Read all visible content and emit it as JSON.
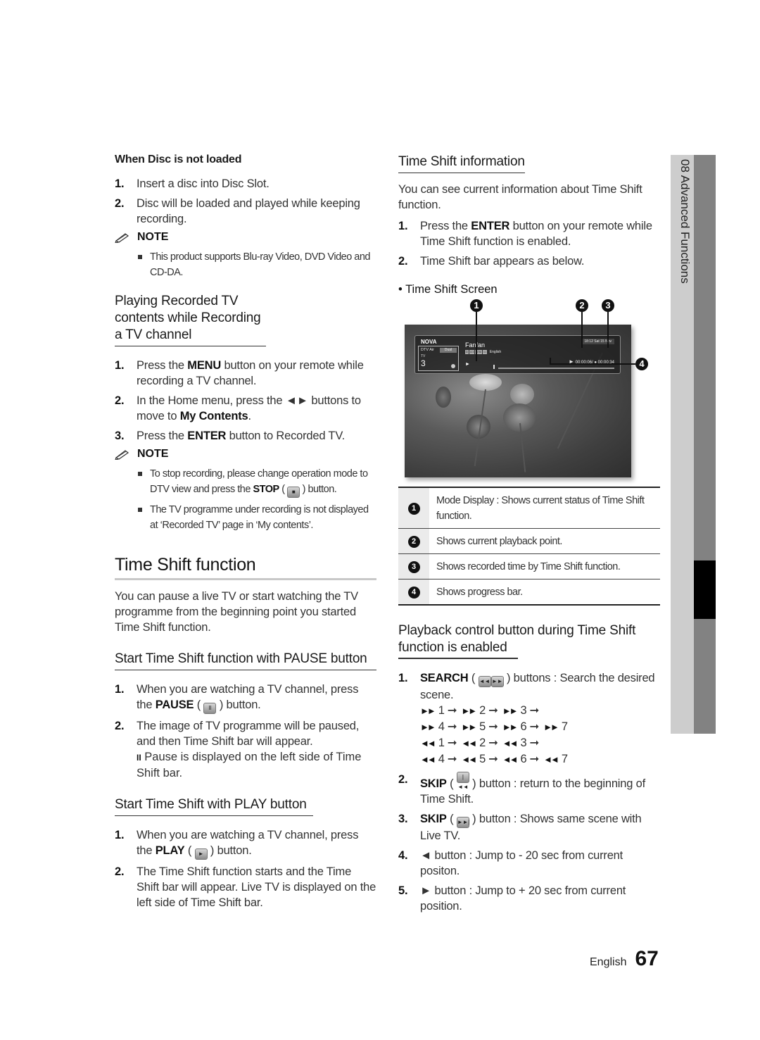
{
  "left": {
    "disc_not_loaded": {
      "title": "When Disc is not loaded",
      "steps": [
        {
          "num": "1.",
          "text": "Insert a disc into Disc Slot."
        },
        {
          "num": "2.",
          "text": "Disc will be loaded and played while keeping recording."
        }
      ],
      "note_label": "NOTE",
      "notes": [
        "This product supports Blu-ray Video, DVD Video and CD-DA."
      ]
    },
    "playing_recorded": {
      "title": "Playing Recorded TV contents while Recording a TV channel",
      "steps": [
        {
          "num": "1.",
          "pre": "Press the ",
          "kw": "MENU",
          "post": " button on your remote while recording a TV channel."
        },
        {
          "num": "2.",
          "pre": "In the Home menu, press the ◄► buttons to move to ",
          "kw": "My Contents",
          "post": "."
        },
        {
          "num": "3.",
          "pre": "Press the ",
          "kw": "ENTER",
          "post": " button to Recorded TV."
        }
      ],
      "note_label": "NOTE",
      "notes": [
        {
          "pre": "To stop recording, please change operation mode to DTV view and press the ",
          "kw": "STOP",
          "post": " button.",
          "icon": "■"
        },
        {
          "text": "The TV programme under recording is not displayed at ‘Recorded TV’ page in ‘My contents’."
        }
      ]
    },
    "time_shift_function": {
      "title": "Time Shift function",
      "intro": "You can pause a live TV or start watching the TV programme from the beginning point you started Time Shift function."
    },
    "pause_section": {
      "title": "Start Time Shift function with PAUSE button",
      "steps": [
        {
          "num": "1.",
          "pre": "When you are watching a TV channel, press the ",
          "kw": "PAUSE",
          "post": " button.",
          "icon": "II"
        },
        {
          "num": "2.",
          "text": "The image of TV programme will be paused, and then Time Shift bar will appear."
        }
      ],
      "pause_note": "Pause is displayed on the left side of Time Shift bar.",
      "pause_glyph": "II"
    },
    "play_section": {
      "title": "Start Time Shift with PLAY button",
      "steps": [
        {
          "num": "1.",
          "pre": "When you are watching a TV channel, press the ",
          "kw": "PLAY",
          "post": " button.",
          "icon": "►"
        },
        {
          "num": "2.",
          "text": "The Time Shift function starts and the Time Shift bar will appear. Live TV is displayed on the left side of Time Shift bar."
        }
      ]
    }
  },
  "right": {
    "info": {
      "title": "Time Shift information",
      "intro": "You can see current information about Time Shift function.",
      "steps": [
        {
          "num": "1.",
          "pre": "Press the ",
          "kw": "ENTER",
          "post": " button on your remote while Time Shift function is enabled."
        },
        {
          "num": "2.",
          "text": "Time Shift bar appears as below."
        }
      ],
      "screen_label": "Time Shift Screen"
    },
    "tv_screen": {
      "callouts": [
        "1",
        "2",
        "3",
        "4"
      ],
      "channel_name": "NOVA",
      "source": "DTV Air",
      "audio": "Dual",
      "type": "TV",
      "channel_number": "3",
      "programme": "Fanfan",
      "tags": [
        "D",
        "4:3",
        "576i",
        "▭"
      ],
      "language": "English",
      "datetime": "18:12 Sat 15 Nov",
      "mode_glyph": "►",
      "playback_point": "00:00:06/",
      "recorded_time": "00:00:34",
      "progress": 0
    },
    "legend": [
      {
        "num": "1",
        "text": "Mode Display : Shows current status of Time Shift function."
      },
      {
        "num": "2",
        "text": "Shows current playback point."
      },
      {
        "num": "3",
        "text": "Shows recorded time by Time Shift function."
      },
      {
        "num": "4",
        "text": "Shows progress bar."
      }
    ],
    "playback": {
      "title": "Playback control button during Time Shift function is enabled",
      "steps": [
        {
          "num": "1.",
          "kw": "SEARCH",
          "icons": [
            "◄◄",
            "►►"
          ],
          "post": " buttons : Search the desired scene."
        },
        {
          "num": "2.",
          "kw": "SKIP",
          "icons": [
            "|◄◄"
          ],
          "post": " button : return to the beginning of Time Shift."
        },
        {
          "num": "3.",
          "kw": "SKIP",
          "icons": [
            "►►|"
          ],
          "post": " button : Shows same scene with Live TV."
        },
        {
          "num": "4.",
          "text": "◄ button : Jump to - 20 sec from current positon."
        },
        {
          "num": "5.",
          "text": "► button : Jump to + 20 sec from current position."
        }
      ],
      "search_sequences": {
        "forward_glyph": "►►",
        "rewind_glyph": "◄◄",
        "arrow": "➞",
        "rows": [
          {
            "dir": "forward",
            "speeds": [
              "1",
              "2",
              "3"
            ],
            "trailing_arrow": true
          },
          {
            "dir": "forward",
            "speeds": [
              "4",
              "5",
              "6",
              "7"
            ],
            "trailing_arrow": false
          },
          {
            "dir": "rewind",
            "speeds": [
              "1",
              "2",
              "3"
            ],
            "trailing_arrow": true
          },
          {
            "dir": "rewind",
            "speeds": [
              "4",
              "5",
              "6",
              "7"
            ],
            "trailing_arrow": false
          }
        ]
      }
    }
  },
  "side_tab": {
    "label": "08  Advanced Functions"
  },
  "footer": {
    "language": "English",
    "page_number": "67"
  }
}
